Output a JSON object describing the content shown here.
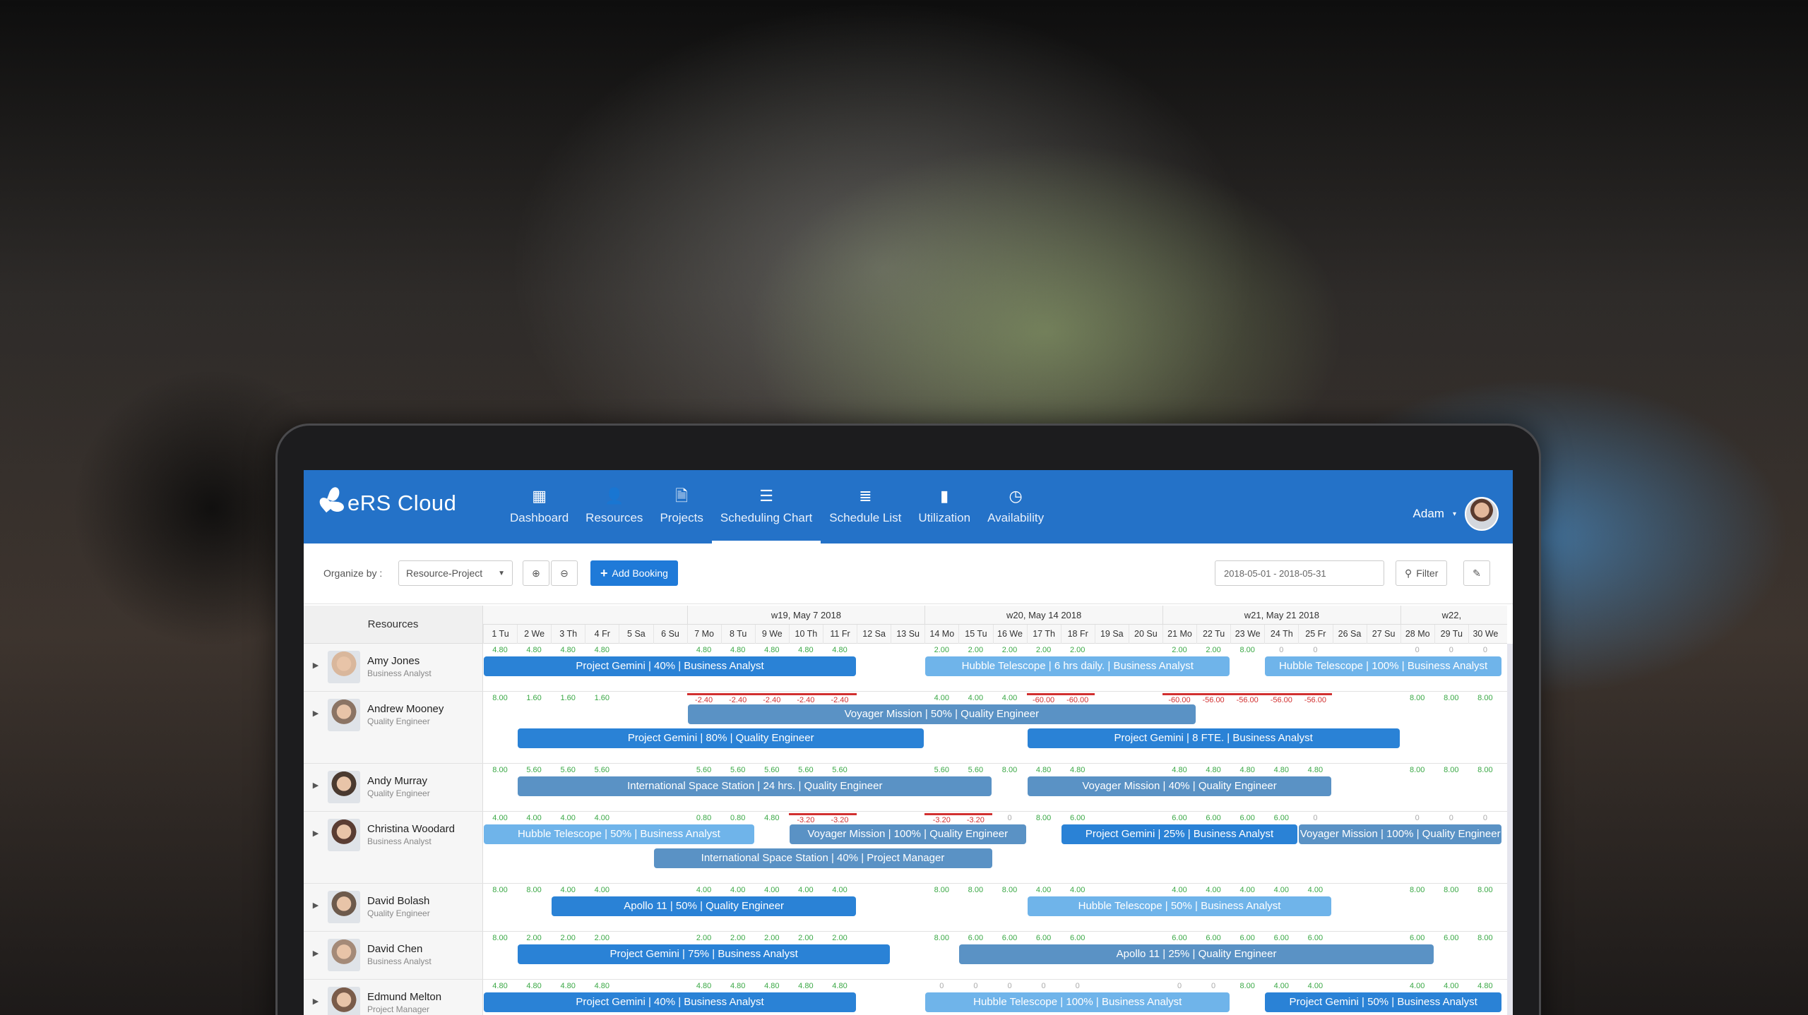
{
  "app": {
    "name": "eRS Cloud",
    "user": "Adam"
  },
  "nav": [
    {
      "label": "Dashboard",
      "icon": "dashboard-icon",
      "glyph": "▦"
    },
    {
      "label": "Resources",
      "icon": "user-icon",
      "glyph": "👤"
    },
    {
      "label": "Projects",
      "icon": "file-icon",
      "glyph": "🗎"
    },
    {
      "label": "Scheduling Chart",
      "icon": "scheduling-icon",
      "glyph": "☰",
      "active": true
    },
    {
      "label": "Schedule List",
      "icon": "list-icon",
      "glyph": "≣"
    },
    {
      "label": "Utilization",
      "icon": "bar-chart-icon",
      "glyph": "▮"
    },
    {
      "label": "Availability",
      "icon": "clock-icon",
      "glyph": "◷"
    }
  ],
  "toolbar": {
    "organize_label": "Organize by :",
    "organize_value": "Resource-Project",
    "add_booking": "Add Booking",
    "date_range": "2018-05-01 - 2018-05-31",
    "filter": "Filter"
  },
  "grid": {
    "resources_header": "Resources",
    "weeks": [
      "w19, May 7 2018",
      "w20, May 14 2018",
      "w21, May 21 2018",
      "w22,"
    ],
    "days": [
      "1 Tu",
      "2 We",
      "3 Th",
      "4 Fr",
      "5 Sa",
      "6 Su",
      "7 Mo",
      "8 Tu",
      "9 We",
      "10 Th",
      "11 Fr",
      "12 Sa",
      "13 Su",
      "14 Mo",
      "15 Tu",
      "16 We",
      "17 Th",
      "18 Fr",
      "19 Sa",
      "20 Su",
      "21 Mo",
      "22 Tu",
      "23 We",
      "24 Th",
      "25 Fr",
      "26 Sa",
      "27 Su",
      "28 Mo",
      "29 Tu",
      "30 We"
    ]
  },
  "resources": [
    {
      "name": "Amy Jones",
      "role": "Business Analyst",
      "values": [
        "4.80",
        "4.80",
        "4.80",
        "4.80",
        "",
        "",
        "4.80",
        "4.80",
        "4.80",
        "4.80",
        "4.80",
        "",
        "",
        "2.00",
        "2.00",
        "2.00",
        "2.00",
        "2.00",
        "",
        "",
        "2.00",
        "2.00",
        "8.00",
        "0",
        "0",
        "",
        "",
        "0",
        "0",
        "0"
      ],
      "bars": [
        {
          "label": "Project Gemini | 40% | Business Analyst",
          "start": 0,
          "span": 11,
          "lane": 0,
          "style": "b1"
        },
        {
          "label": "Hubble Telescope | 6 hrs daily. | Business Analyst",
          "start": 13,
          "span": 9,
          "lane": 0,
          "style": "b2"
        },
        {
          "label": "Hubble Telescope | 100% | Business Analyst",
          "start": 23,
          "span": 7,
          "lane": 0,
          "style": "b2"
        }
      ]
    },
    {
      "name": "Andrew Mooney",
      "role": "Quality Engineer",
      "values": [
        "8.00",
        "1.60",
        "1.60",
        "1.60",
        "",
        "",
        "-2.40",
        "-2.40",
        "-2.40",
        "-2.40",
        "-2.40",
        "",
        "",
        "4.00",
        "4.00",
        "4.00",
        "-60.00",
        "-60.00",
        "",
        "",
        "-60.00",
        "-56.00",
        "-56.00",
        "-56.00",
        "-56.00",
        "",
        "",
        "8.00",
        "8.00",
        "8.00"
      ],
      "bars": [
        {
          "label": "Voyager Mission | 50% | Quality Engineer",
          "start": 6,
          "span": 15,
          "lane": 0,
          "style": "b3"
        },
        {
          "label": "Project Gemini | 80% | Quality Engineer",
          "start": 1,
          "span": 12,
          "lane": 1,
          "style": "b1"
        },
        {
          "label": "Project Gemini | 8 FTE. | Business Analyst",
          "start": 16,
          "span": 11,
          "lane": 1,
          "style": "b1"
        }
      ]
    },
    {
      "name": "Andy Murray",
      "role": "Quality Engineer",
      "values": [
        "8.00",
        "5.60",
        "5.60",
        "5.60",
        "",
        "",
        "5.60",
        "5.60",
        "5.60",
        "5.60",
        "5.60",
        "",
        "",
        "5.60",
        "5.60",
        "8.00",
        "4.80",
        "4.80",
        "",
        "",
        "4.80",
        "4.80",
        "4.80",
        "4.80",
        "4.80",
        "",
        "",
        "8.00",
        "8.00",
        "8.00"
      ],
      "bars": [
        {
          "label": "International Space Station | 24 hrs. | Quality Engineer",
          "start": 1,
          "span": 14,
          "lane": 0,
          "style": "b3"
        },
        {
          "label": "Voyager Mission | 40% | Quality Engineer",
          "start": 16,
          "span": 9,
          "lane": 0,
          "style": "b3"
        }
      ]
    },
    {
      "name": "Christina Woodard",
      "role": "Business Analyst",
      "values": [
        "4.00",
        "4.00",
        "4.00",
        "4.00",
        "",
        "",
        "0.80",
        "0.80",
        "4.80",
        "-3.20",
        "-3.20",
        "",
        "",
        "-3.20",
        "-3.20",
        "0",
        "8.00",
        "6.00",
        "",
        "",
        "6.00",
        "6.00",
        "6.00",
        "6.00",
        "0",
        "",
        "",
        "0",
        "0",
        "0"
      ],
      "bars": [
        {
          "label": "Hubble Telescope | 50% | Business Analyst",
          "start": 0,
          "span": 8,
          "lane": 0,
          "style": "b2"
        },
        {
          "label": "Voyager Mission | 100% | Quality Engineer",
          "start": 9,
          "span": 7,
          "lane": 0,
          "style": "b3"
        },
        {
          "label": "Project Gemini | 25% | Business Analyst",
          "start": 17,
          "span": 7,
          "lane": 0,
          "style": "b1"
        },
        {
          "label": "Voyager Mission | 100% | Quality Engineer",
          "start": 24,
          "span": 6,
          "lane": 0,
          "style": "b3"
        },
        {
          "label": "International Space Station | 40% | Project Manager",
          "start": 5,
          "span": 10,
          "lane": 1,
          "style": "b3"
        }
      ]
    },
    {
      "name": "David Bolash",
      "role": "Quality Engineer",
      "values": [
        "8.00",
        "8.00",
        "4.00",
        "4.00",
        "",
        "",
        "4.00",
        "4.00",
        "4.00",
        "4.00",
        "4.00",
        "",
        "",
        "8.00",
        "8.00",
        "8.00",
        "4.00",
        "4.00",
        "",
        "",
        "4.00",
        "4.00",
        "4.00",
        "4.00",
        "4.00",
        "",
        "",
        "8.00",
        "8.00",
        "8.00"
      ],
      "bars": [
        {
          "label": "Apollo 11 | 50% | Quality Engineer",
          "start": 2,
          "span": 9,
          "lane": 0,
          "style": "b1"
        },
        {
          "label": "Hubble Telescope | 50% | Business Analyst",
          "start": 16,
          "span": 9,
          "lane": 0,
          "style": "b2"
        }
      ]
    },
    {
      "name": "David Chen",
      "role": "Business Analyst",
      "values": [
        "8.00",
        "2.00",
        "2.00",
        "2.00",
        "",
        "",
        "2.00",
        "2.00",
        "2.00",
        "2.00",
        "2.00",
        "",
        "",
        "8.00",
        "6.00",
        "6.00",
        "6.00",
        "6.00",
        "",
        "",
        "6.00",
        "6.00",
        "6.00",
        "6.00",
        "6.00",
        "",
        "",
        "6.00",
        "6.00",
        "8.00"
      ],
      "bars": [
        {
          "label": "Project Gemini | 75% | Business Analyst",
          "start": 1,
          "span": 11,
          "lane": 0,
          "style": "b1"
        },
        {
          "label": "Apollo 11 | 25% | Quality Engineer",
          "start": 14,
          "span": 14,
          "lane": 0,
          "style": "b3"
        }
      ]
    },
    {
      "name": "Edmund Melton",
      "role": "Project Manager",
      "values": [
        "4.80",
        "4.80",
        "4.80",
        "4.80",
        "",
        "",
        "4.80",
        "4.80",
        "4.80",
        "4.80",
        "4.80",
        "",
        "",
        "0",
        "0",
        "0",
        "0",
        "0",
        "",
        "",
        "0",
        "0",
        "8.00",
        "4.00",
        "4.00",
        "",
        "",
        "4.00",
        "4.00",
        "4.80"
      ],
      "bars": [
        {
          "label": "Project Gemini | 40% | Business Analyst",
          "start": 0,
          "span": 11,
          "lane": 0,
          "style": "b1"
        },
        {
          "label": "Hubble Telescope | 100% | Business Analyst",
          "start": 13,
          "span": 9,
          "lane": 0,
          "style": "b2"
        },
        {
          "label": "Project Gemini | 50% | Business Analyst",
          "start": 23,
          "span": 7,
          "lane": 0,
          "style": "b1"
        }
      ]
    }
  ]
}
